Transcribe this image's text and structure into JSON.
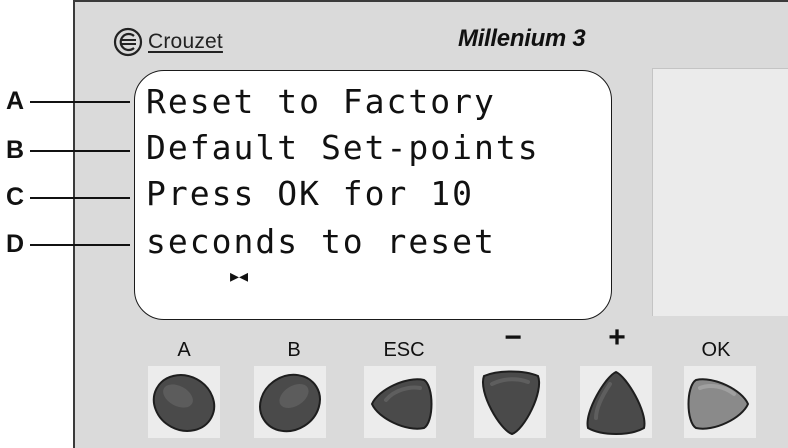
{
  "brand": {
    "name": "Crouzet",
    "logo_icon": "crouzet-logo-icon"
  },
  "model": "Millenium 3",
  "display": {
    "lines": [
      "Reset to Factory",
      "Default Set-points",
      "Press OK for 10",
      "seconds to reset"
    ],
    "cursor": "▸◂"
  },
  "callouts": [
    "A",
    "B",
    "C",
    "D"
  ],
  "buttons": [
    {
      "label": "A",
      "icon": "oval-button-icon"
    },
    {
      "label": "B",
      "icon": "oval-button-icon"
    },
    {
      "label": "ESC",
      "icon": "left-arrow-button-icon"
    },
    {
      "label": "−",
      "icon": "down-arrow-button-icon"
    },
    {
      "label": "+",
      "icon": "up-arrow-button-icon"
    },
    {
      "label": "OK",
      "icon": "right-arrow-button-icon"
    }
  ],
  "colors": {
    "panel": "#dadada",
    "button_dark": "#4a4a4a",
    "button_ok": "#8a8a8a",
    "lcd": "#ffffff"
  }
}
